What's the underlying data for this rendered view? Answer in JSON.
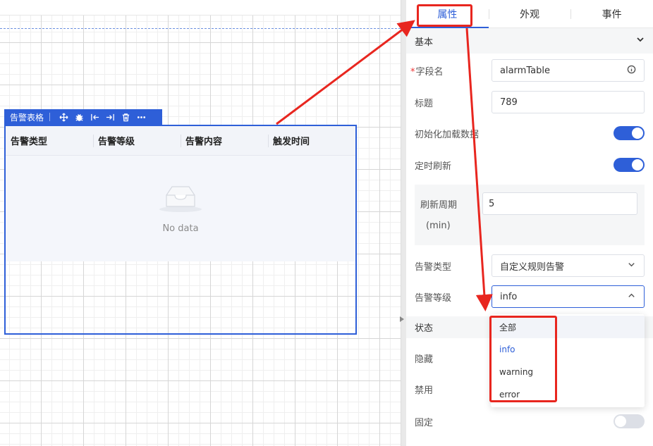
{
  "component": {
    "label": "告警表格",
    "columns": [
      "告警类型",
      "告警等级",
      "告警内容",
      "触发时间"
    ],
    "empty_text": "No data"
  },
  "tabs": [
    "属性",
    "外观",
    "事件"
  ],
  "groups": {
    "basic": "基本",
    "status": "状态"
  },
  "fields": {
    "field_name": {
      "label": "字段名",
      "value": "alarmTable"
    },
    "title": {
      "label": "标题",
      "value": "789"
    },
    "init_load": {
      "label": "初始化加载数据",
      "on": true
    },
    "timed_refresh": {
      "label": "定时刷新",
      "on": true
    },
    "refresh_period": {
      "label": "刷新周期",
      "unit": "(min)",
      "value": "5"
    },
    "alarm_type": {
      "label": "告警类型",
      "value": "自定义规则告警"
    },
    "alarm_level": {
      "label": "告警等级",
      "value": "info"
    },
    "hidden": {
      "label": "隐藏"
    },
    "disabled": {
      "label": "禁用"
    },
    "fixed": {
      "label": "固定",
      "on": false
    }
  },
  "dropdown": {
    "options": [
      "全部",
      "info",
      "warning",
      "error"
    ],
    "selected": "info",
    "hovered": "全部"
  },
  "colors": {
    "accent": "#2e5fd8",
    "annotation": "#e8261f"
  },
  "icons": [
    "move-icon",
    "bug-icon",
    "align-left-icon",
    "align-right-icon",
    "delete-icon",
    "more-icon",
    "info-icon",
    "chevron-down-icon",
    "chevron-up-icon",
    "empty-inbox-icon"
  ]
}
